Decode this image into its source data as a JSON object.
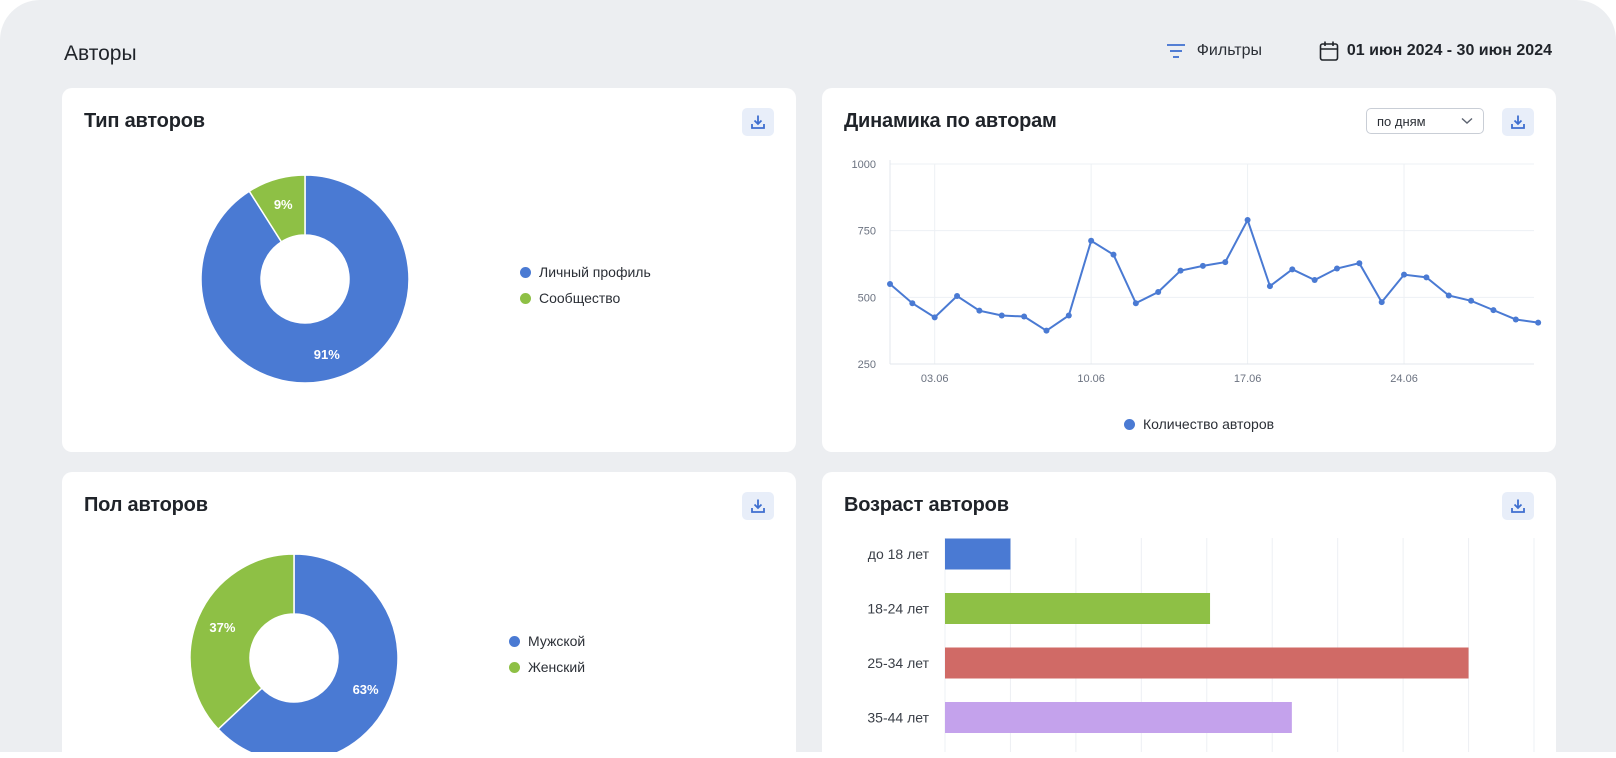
{
  "page": {
    "title": "Авторы",
    "filters_label": "Фильтры",
    "date_range": "01 июн 2024 - 30 июн 2024"
  },
  "colors": {
    "blue": "#4a7ad3",
    "green": "#8ec045",
    "red": "#d06a66",
    "violet": "#c4a2ec",
    "background": "#eceef1",
    "button_bg": "#e8eef9",
    "accent_icon": "#3f6fd0"
  },
  "icons": {
    "filters": "filter-lines-icon",
    "calendar": "calendar-icon",
    "download": "download-icon",
    "dropdown": "chevron-down-icon"
  },
  "author_type": {
    "title": "Тип авторов",
    "legend": [
      "Личный профиль",
      "Сообщество"
    ]
  },
  "dynamics": {
    "title": "Динамика по авторам",
    "period_select": "по дням",
    "legend": "Количество авторов"
  },
  "gender": {
    "title": "Пол авторов",
    "legend": [
      "Мужской",
      "Женский"
    ]
  },
  "age": {
    "title": "Возраст авторов"
  },
  "chart_data": [
    {
      "id": "author_type",
      "type": "pie",
      "labels": [
        "Личный профиль",
        "Сообщество"
      ],
      "values": [
        91,
        9
      ],
      "value_labels": [
        "91%",
        "9%"
      ],
      "colors": [
        "#4a7ad3",
        "#8ec045"
      ],
      "donut": true,
      "legend_position": "right"
    },
    {
      "id": "dynamics",
      "type": "line",
      "x": [
        "01.06",
        "02.06",
        "03.06",
        "04.06",
        "05.06",
        "06.06",
        "07.06",
        "08.06",
        "09.06",
        "10.06",
        "11.06",
        "12.06",
        "13.06",
        "14.06",
        "15.06",
        "16.06",
        "17.06",
        "18.06",
        "19.06",
        "20.06",
        "21.06",
        "22.06",
        "23.06",
        "24.06",
        "25.06",
        "26.06",
        "27.06",
        "28.06",
        "29.06",
        "30.06"
      ],
      "series": [
        {
          "name": "Количество авторов",
          "color": "#4a7ad3",
          "values": [
            550,
            478,
            425,
            505,
            450,
            432,
            428,
            375,
            432,
            712,
            660,
            478,
            520,
            600,
            618,
            632,
            790,
            542,
            605,
            565,
            608,
            628,
            482,
            585,
            575,
            507,
            487,
            452,
            417,
            405
          ]
        }
      ],
      "x_tick_labels": [
        "03.06",
        "10.06",
        "17.06",
        "24.06"
      ],
      "y_ticks": [
        250,
        500,
        750,
        1000
      ],
      "ylim": [
        250,
        1000
      ],
      "grid": true,
      "legend_position": "bottom"
    },
    {
      "id": "gender",
      "type": "pie",
      "labels": [
        "Мужской",
        "Женский"
      ],
      "values": [
        63,
        37
      ],
      "value_labels": [
        "63%",
        "37%"
      ],
      "colors": [
        "#4a7ad3",
        "#8ec045"
      ],
      "donut": true,
      "legend_position": "right"
    },
    {
      "id": "age",
      "type": "bar",
      "orientation": "horizontal",
      "categories": [
        "до 18 лет",
        "18-24 лет",
        "25-34 лет",
        "35-44 лет"
      ],
      "values": [
        1,
        4.05,
        8,
        5.3
      ],
      "colors": [
        "#4a7ad3",
        "#8ec045",
        "#d06a66",
        "#c4a2ec"
      ],
      "xlim": [
        0,
        9
      ],
      "grid": true
    }
  ]
}
